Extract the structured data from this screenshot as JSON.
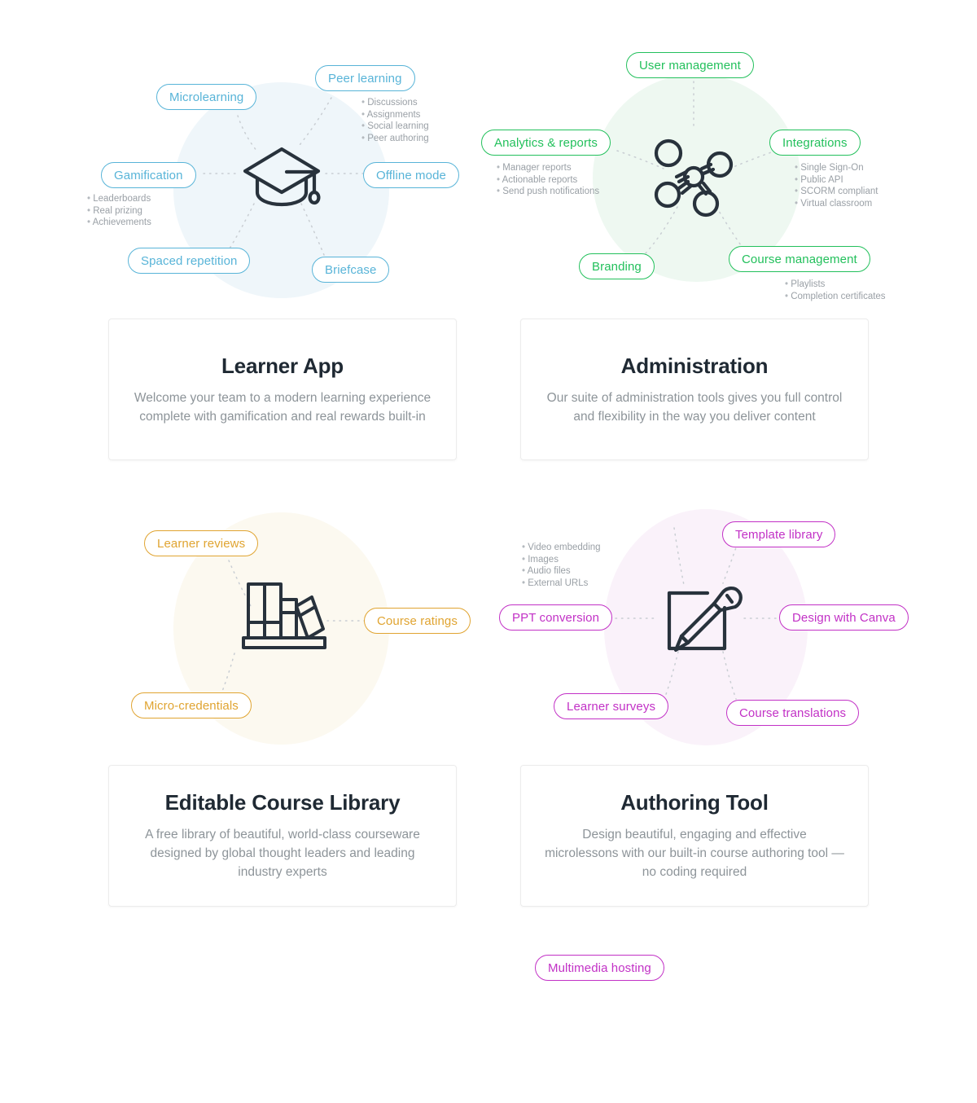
{
  "colors": {
    "learner_app": "#58b4d8",
    "administration": "#23c05c",
    "course_library": "#e0a431",
    "authoring_tool": "#c231c6",
    "icon_stroke": "#28323c",
    "body_text": "#8d9499",
    "heading_text": "#1f2933",
    "bullet_text": "#9aa0a6"
  },
  "sections": {
    "learner_app": {
      "icon": "graduation-cap-icon",
      "pills": [
        {
          "label": "Peer learning"
        },
        {
          "label": "Microlearning"
        },
        {
          "label": "Gamification"
        },
        {
          "label": "Offline mode"
        },
        {
          "label": "Spaced repetition"
        },
        {
          "label": "Briefcase"
        }
      ],
      "bullets_peer_learning": [
        "Discussions",
        "Assignments",
        "Social learning",
        "Peer authoring"
      ],
      "bullets_gamification": [
        "Leaderboards",
        "Real prizing",
        "Achievements"
      ],
      "card": {
        "title": "Learner App",
        "description": "Welcome your team to a modern learning experience complete with gamification and real rewards built-in"
      }
    },
    "administration": {
      "icon": "network-nodes-icon",
      "pills": [
        {
          "label": "User management"
        },
        {
          "label": "Analytics & reports"
        },
        {
          "label": "Integrations"
        },
        {
          "label": "Branding"
        },
        {
          "label": "Course management"
        }
      ],
      "bullets_analytics": [
        "Manager reports",
        "Actionable reports",
        "Send push notifications"
      ],
      "bullets_integrations": [
        "Single Sign-On",
        "Public API",
        "SCORM compliant",
        "Virtual classroom"
      ],
      "bullets_course_management": [
        "Playlists",
        "Completion certificates"
      ],
      "card": {
        "title": "Administration",
        "description": "Our suite of administration tools gives you full control and flexibility in the way you deliver content"
      }
    },
    "course_library": {
      "icon": "books-shelf-icon",
      "pills": [
        {
          "label": "Learner reviews"
        },
        {
          "label": "Course ratings"
        },
        {
          "label": "Micro-credentials"
        }
      ],
      "card": {
        "title": "Editable Course Library",
        "description": "A free library of beautiful, world-class courseware designed by global thought leaders and leading industry experts"
      }
    },
    "authoring_tool": {
      "icon": "pencil-square-icon",
      "pills": [
        {
          "label": "Multimedia hosting"
        },
        {
          "label": "Template library"
        },
        {
          "label": "PPT conversion"
        },
        {
          "label": "Design with Canva"
        },
        {
          "label": "Learner surveys"
        },
        {
          "label": "Course translations"
        }
      ],
      "bullets_multimedia": [
        "Video embedding",
        "Images",
        "Audio files",
        "External URLs"
      ],
      "card": {
        "title": "Authoring Tool",
        "description": "Design beautiful, engaging and effective microlessons with our built-in course authoring tool — no coding required"
      }
    }
  }
}
